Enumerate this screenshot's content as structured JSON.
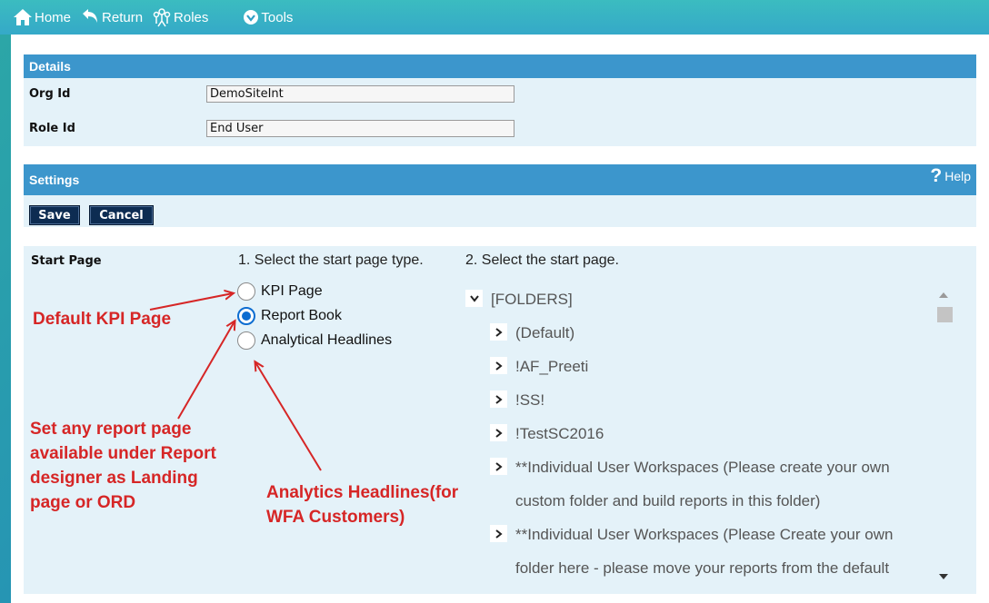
{
  "nav": {
    "home": "Home",
    "return": "Return",
    "roles": "Roles",
    "tools": "Tools"
  },
  "details": {
    "title": "Details",
    "org_label": "Org Id",
    "org_value": "DemoSiteInt",
    "role_label": "Role Id",
    "role_value": "End User"
  },
  "settings": {
    "title": "Settings",
    "help_label": "Help",
    "save_label": "Save",
    "cancel_label": "Cancel"
  },
  "start_page": {
    "label": "Start Page",
    "step1": "1. Select the start page type.",
    "step2": "2. Select the start page.",
    "options": [
      "KPI Page",
      "Report Book",
      "Analytical Headlines"
    ],
    "selected": "Report Book",
    "tree": {
      "root": "[FOLDERS]",
      "items": [
        "(Default)",
        "!AF_Preeti",
        "!SS!",
        "!TestSC2016",
        "**Individual User Workspaces (Please create your own",
        "custom folder and build reports in this folder)",
        "**Individual User Workspaces (Please Create your own",
        "folder here - please move your reports from the default"
      ]
    }
  },
  "annotations": {
    "kpi": "Default KPI Page",
    "report_lines": [
      "Set any report page",
      "available under Report",
      "designer as Landing",
      "page or ORD"
    ],
    "analytics_lines": [
      "Analytics Headlines(for",
      "WFA Customers)"
    ]
  },
  "colors": {
    "section_bar": "#3c96cc",
    "panel": "#e4f2f9",
    "button": "#0d2c52",
    "annotation": "#d62626",
    "radio_selected": "#0d6dd1"
  }
}
